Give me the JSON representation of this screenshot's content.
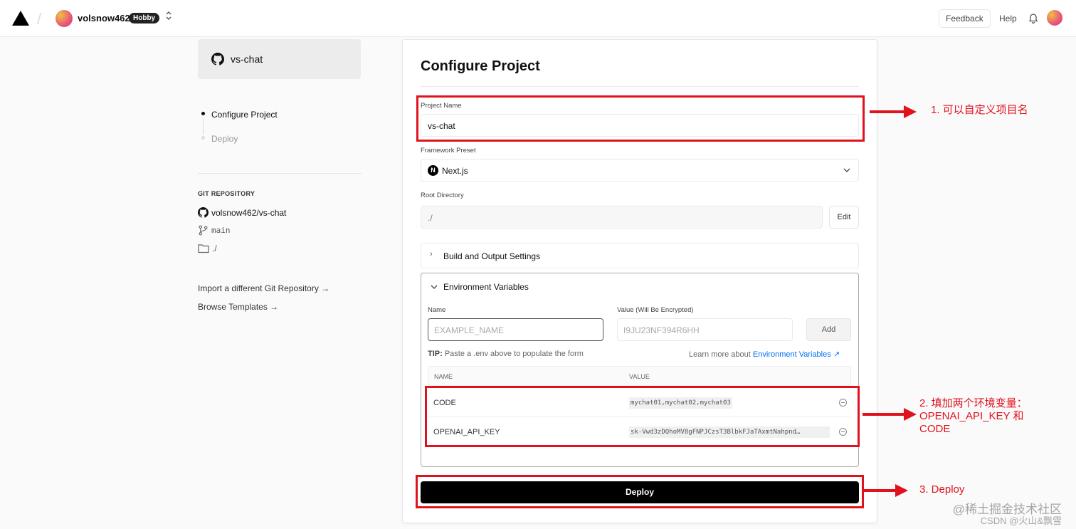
{
  "header": {
    "username": "volsnow462",
    "plan_badge": "Hobby",
    "switcher_icon": "⌃\n⌄",
    "feedback_label": "Feedback",
    "help_label": "Help"
  },
  "sidebar": {
    "repo_card_name": "vs-chat",
    "steps": [
      {
        "label": "Configure Project",
        "active": true
      },
      {
        "label": "Deploy",
        "active": false
      }
    ],
    "git_section_label": "GIT REPOSITORY",
    "repo_full_name": "volsnow462/vs-chat",
    "branch": "main",
    "directory": "./",
    "import_link": "Import a different Git Repository →",
    "browse_link": "Browse Templates →"
  },
  "configure": {
    "title": "Configure Project",
    "project_name_label": "Project Name",
    "project_name_value": "vs-chat",
    "framework_label": "Framework Preset",
    "framework_value": "Next.js",
    "root_dir_label": "Root Directory",
    "root_dir_value": "./",
    "edit_label": "Edit",
    "build_settings_label": "Build and Output Settings",
    "env": {
      "section_label": "Environment Variables",
      "name_label": "Name",
      "value_label": "Value (Will Be Encrypted)",
      "name_placeholder": "EXAMPLE_NAME",
      "value_placeholder": "I9JU23NF394R6HH",
      "add_label": "Add",
      "tip_prefix": "TIP:",
      "tip_text": " Paste a .env above to populate the form",
      "learn_prefix": "Learn more about ",
      "learn_link": "Environment Variables",
      "table_name_header": "NAME",
      "table_value_header": "VALUE",
      "rows": [
        {
          "name": "CODE",
          "value": "mychat01,mychat02,mychat03"
        },
        {
          "name": "OPENAI_API_KEY",
          "value": "sk-Vwd3zDQhoMV8gFNPJCzsT3BlbkFJaTAxmtNahpnd…"
        }
      ]
    },
    "deploy_label": "Deploy"
  },
  "annotations": {
    "note1": "1. 可以自定义项目名",
    "note2_line1": "2. 填加两个环境变量：",
    "note2_line2": "OPENAI_API_KEY 和",
    "note2_line3": "CODE",
    "note3": "3. Deploy",
    "color": "#e0131d"
  },
  "watermark": {
    "line1": "@稀土掘金技术社区",
    "line2": "CSDN @火山&飘雪"
  }
}
